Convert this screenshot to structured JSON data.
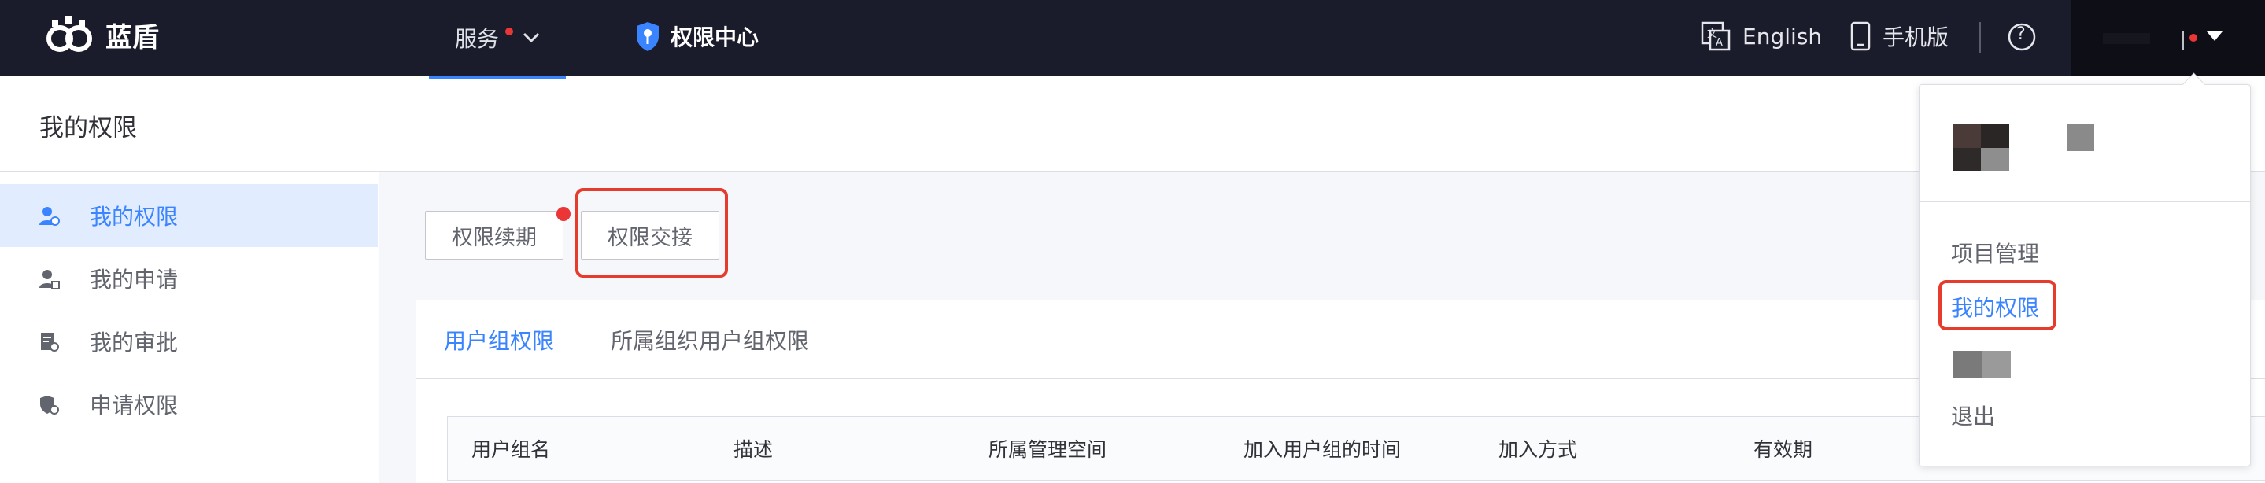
{
  "topnav": {
    "logo_text": "蓝盾",
    "service_label": "服务",
    "perm_center_label": "权限中心",
    "language_label": "English",
    "mobile_label": "手机版",
    "help_symbol": "?"
  },
  "header": {
    "page_title": "我的权限"
  },
  "sidebar": {
    "items": [
      {
        "label": "我的权限",
        "icon": "user-permission-icon",
        "active": true
      },
      {
        "label": "我的申请",
        "icon": "user-apply-icon",
        "active": false
      },
      {
        "label": "我的审批",
        "icon": "approval-icon",
        "active": false
      },
      {
        "label": "申请权限",
        "icon": "apply-permission-icon",
        "active": false
      }
    ]
  },
  "actions": {
    "renew_label": "权限续期",
    "handover_label": "权限交接"
  },
  "tabs": [
    {
      "label": "用户组权限",
      "active": true
    },
    {
      "label": "所属组织用户组权限",
      "active": false
    }
  ],
  "table": {
    "columns": [
      "用户组名",
      "描述",
      "所属管理空间",
      "加入用户组的时间",
      "加入方式",
      "有效期"
    ]
  },
  "user_menu": {
    "items": [
      "项目管理",
      "我的权限",
      "退出"
    ]
  },
  "colors": {
    "nav_bg": "#1b1c2b",
    "accent": "#3a84ff",
    "highlight": "#e53c2e",
    "badge_red": "#ea3636"
  }
}
